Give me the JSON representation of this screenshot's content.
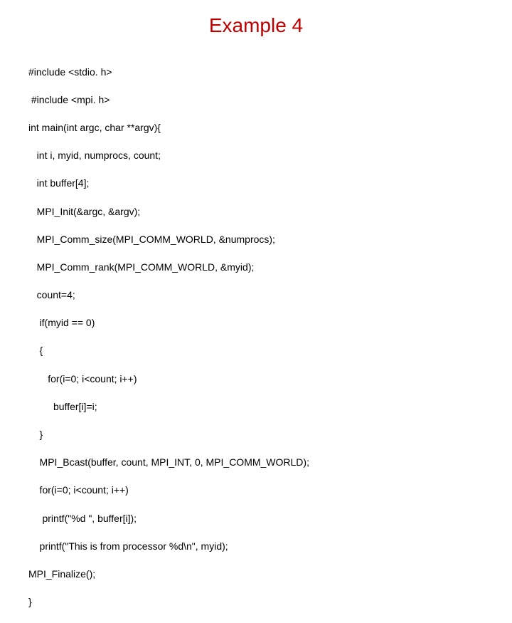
{
  "title": "Example 4",
  "code": {
    "l0": "#include <stdio. h>",
    "l1": " #include <mpi. h>",
    "l2": "int main(int argc, char **argv){",
    "l3": "   int i, myid, numprocs, count;",
    "l4": "   int buffer[4];",
    "l5": "   MPI_Init(&argc, &argv);",
    "l6": "   MPI_Comm_size(MPI_COMM_WORLD, &numprocs);",
    "l7": "   MPI_Comm_rank(MPI_COMM_WORLD, &myid);",
    "l8": "   count=4;",
    "l9": "    if(myid == 0)",
    "l10": "    {",
    "l11": "       for(i=0; i<count; i++)",
    "l12": "         buffer[i]=i;",
    "l13": "    }",
    "l14": "    MPI_Bcast(buffer, count, MPI_INT, 0, MPI_COMM_WORLD);",
    "l15": "    for(i=0; i<count; i++)",
    "l16": "     printf(\"%d \", buffer[i]);",
    "l17": "    printf(\"This is from processor %d\\n\", myid);",
    "l18": "MPI_Finalize();",
    "l19": "}"
  }
}
